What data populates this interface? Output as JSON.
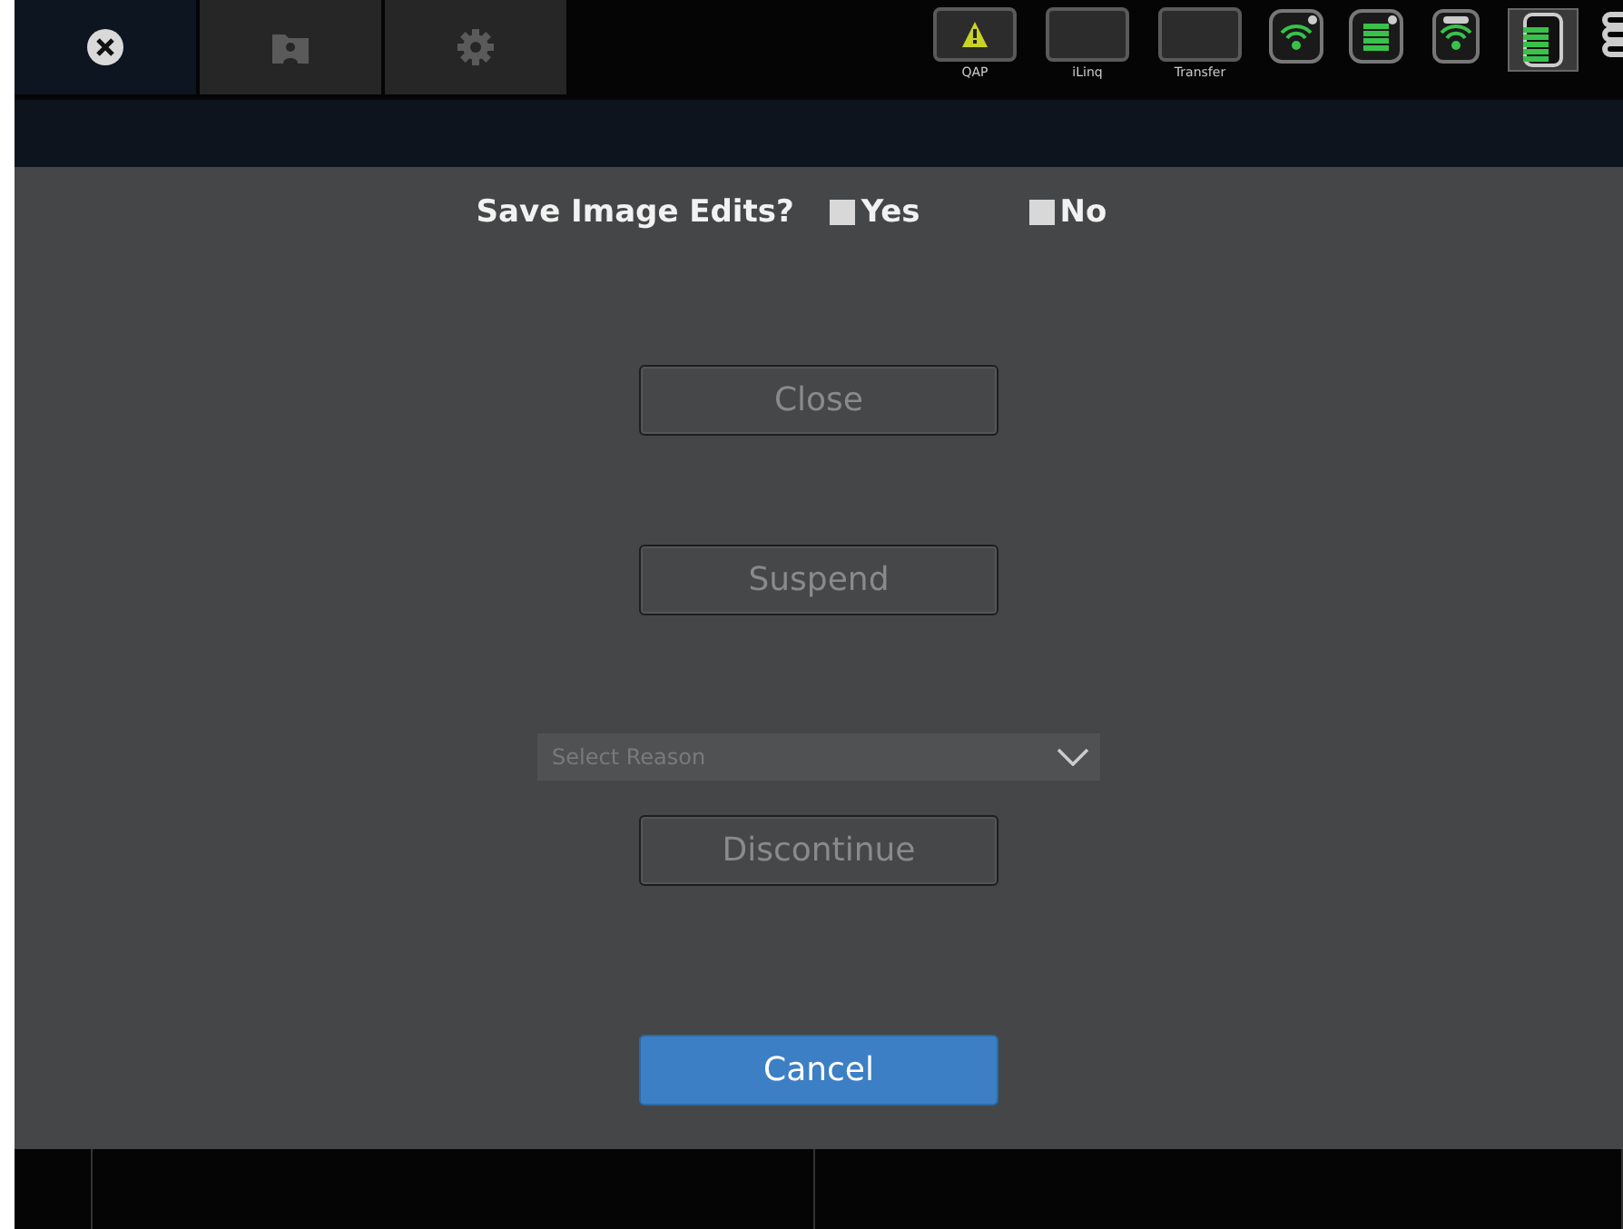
{
  "toolbar": {
    "tabs": [
      {
        "kind": "close",
        "selected": true
      },
      {
        "kind": "folder",
        "selected": false
      },
      {
        "kind": "settings",
        "selected": false
      }
    ],
    "status": [
      {
        "label": "QAP",
        "warning": true
      },
      {
        "label": "iLinq",
        "warning": false
      },
      {
        "label": "Transfer",
        "warning": false
      }
    ]
  },
  "prompt": {
    "question": "Save Image Edits?",
    "options": [
      {
        "label": "Yes",
        "checked": false
      },
      {
        "label": "No",
        "checked": false
      }
    ]
  },
  "actions": [
    {
      "kind": "button",
      "label": "Close",
      "disabled": true
    },
    {
      "kind": "button",
      "label": "Suspend",
      "disabled": true
    },
    {
      "kind": "select",
      "placeholder": "Select Reason"
    },
    {
      "kind": "button",
      "label": "Discontinue",
      "disabled": true
    },
    {
      "kind": "button",
      "label": "Cancel",
      "disabled": false
    }
  ]
}
